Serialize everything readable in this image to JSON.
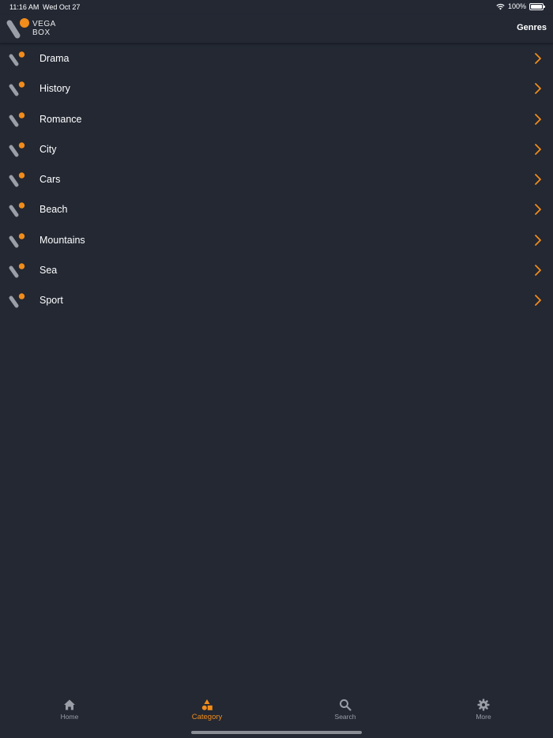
{
  "status_bar": {
    "time": "11:16 AM",
    "date": "Wed Oct 27",
    "battery": "100%"
  },
  "header": {
    "logo_line1": "VEGA",
    "logo_line2": "BOX",
    "title": "Genres"
  },
  "genres": [
    {
      "label": "Drama"
    },
    {
      "label": "History"
    },
    {
      "label": "Romance"
    },
    {
      "label": "City"
    },
    {
      "label": "Cars"
    },
    {
      "label": "Beach"
    },
    {
      "label": "Mountains"
    },
    {
      "label": "Sea"
    },
    {
      "label": "Sport"
    }
  ],
  "tab_bar": {
    "tabs": [
      {
        "label": "Home",
        "icon": "home-icon",
        "active": false
      },
      {
        "label": "Category",
        "icon": "category-icon",
        "active": true
      },
      {
        "label": "Search",
        "icon": "search-icon",
        "active": false
      },
      {
        "label": "More",
        "icon": "gear-icon",
        "active": false
      }
    ]
  },
  "colors": {
    "background": "#232833",
    "accent": "#f28c1a",
    "inactive": "#9a9ea6"
  }
}
